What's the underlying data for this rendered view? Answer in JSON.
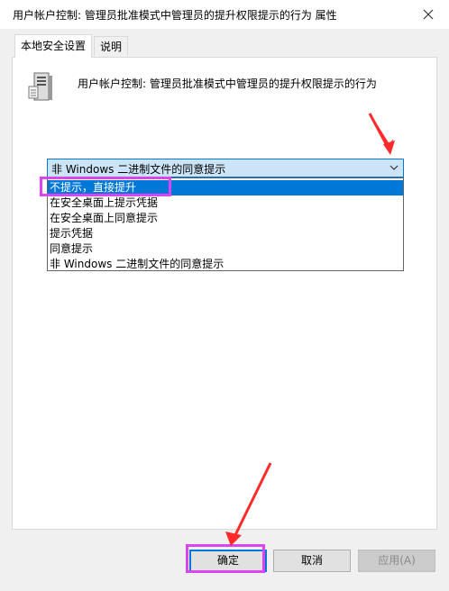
{
  "title": "用户帐户控制: 管理员批准模式中管理员的提升权限提示的行为 属性",
  "tabs": [
    {
      "label": "本地安全设置",
      "active": true
    },
    {
      "label": "说明",
      "active": false
    }
  ],
  "policy_name": "用户帐户控制: 管理员批准模式中管理员的提升权限提示的行为",
  "dropdown": {
    "current_value": "非 Windows 二进制文件的同意提示",
    "options": [
      "不提示，直接提升",
      "在安全桌面上提示凭据",
      "在安全桌面上同意提示",
      "提示凭据",
      "同意提示",
      "非 Windows 二进制文件的同意提示"
    ],
    "highlighted_index": 0
  },
  "buttons": {
    "ok": "确定",
    "cancel": "取消",
    "apply": "应用(A)"
  },
  "colors": {
    "accent": "#0078d7",
    "annotation": "#d946ef",
    "arrow": "#ff2a2a"
  }
}
